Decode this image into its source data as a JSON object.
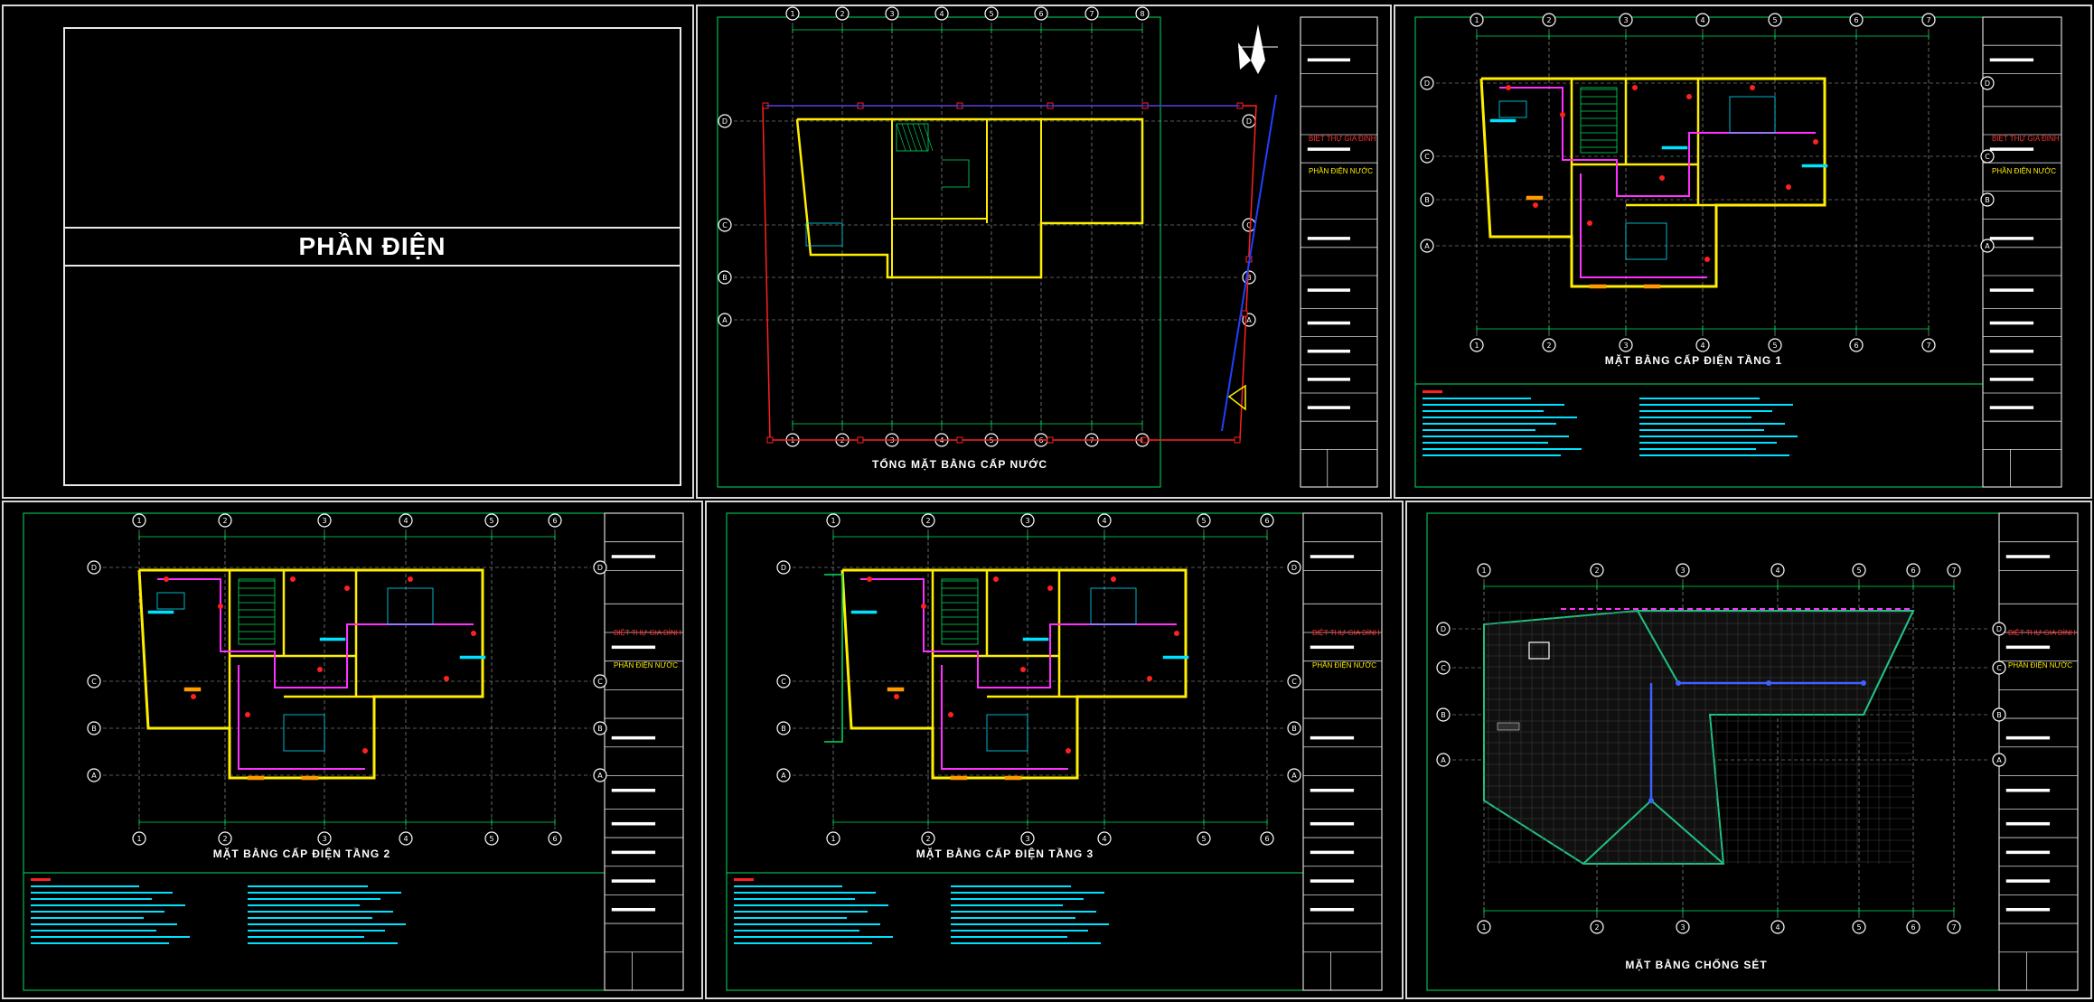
{
  "cover": {
    "title": "PHẦN ĐIỆN"
  },
  "sheets": [
    {
      "id": "s1",
      "title": "TỔNG MẶT BẰNG CẤP NƯỚC",
      "project": "BIỆT THỰ GIA ĐÌNH",
      "part": "PHẦN ĐIỆN NƯỚC"
    },
    {
      "id": "s2",
      "title": "MẶT BẰNG CẤP ĐIỆN TẦNG 1",
      "project": "BIỆT THỰ GIA ĐÌNH",
      "part": "PHẦN ĐIỆN NƯỚC"
    },
    {
      "id": "s3",
      "title": "MẶT BẰNG CẤP ĐIỆN TẦNG 2",
      "project": "BIỆT THỰ GIA ĐÌNH",
      "part": "PHẦN ĐIỆN NƯỚC"
    },
    {
      "id": "s4",
      "title": "MẶT BẰNG CẤP ĐIỆN TẦNG 3",
      "project": "BIỆT THỰ GIA ĐÌNH",
      "part": "PHẦN ĐIỆN NƯỚC"
    },
    {
      "id": "s5",
      "title": "MẶT BẰNG CHỐNG SÉT",
      "project": "BIỆT THỰ GIA ĐÌNH",
      "part": "PHẦN ĐIỆN NƯỚC"
    }
  ],
  "grid_labels": {
    "rows": [
      "D",
      "C",
      "B",
      "A"
    ],
    "cols": [
      "1",
      "2",
      "3",
      "4",
      "5",
      "6",
      "7",
      "8"
    ]
  },
  "colors": {
    "wall": "#ffee00",
    "grid": "#ffffff",
    "green": "#00e060",
    "cyan": "#00e0ff",
    "magenta": "#ff30ff",
    "red": "#ff2020",
    "blue": "#2040ff",
    "border": "#d8d8d8"
  }
}
